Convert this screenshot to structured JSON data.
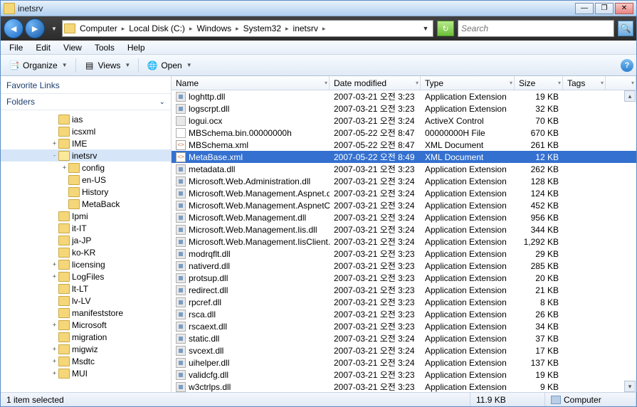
{
  "titlebar": {
    "title": "inetsrv"
  },
  "breadcrumb": [
    "Computer",
    "Local Disk (C:)",
    "Windows",
    "System32",
    "inetsrv"
  ],
  "search": {
    "placeholder": "Search"
  },
  "menubar": [
    "File",
    "Edit",
    "View",
    "Tools",
    "Help"
  ],
  "toolbar": {
    "organize": "Organize",
    "views": "Views",
    "open": "Open"
  },
  "sidebar": {
    "favorites": "Favorite Links",
    "folders_label": "Folders",
    "tree": [
      {
        "depth": 5,
        "label": "ias",
        "exp": ""
      },
      {
        "depth": 5,
        "label": "icsxml",
        "exp": ""
      },
      {
        "depth": 5,
        "label": "IME",
        "exp": "+"
      },
      {
        "depth": 5,
        "label": "inetsrv",
        "exp": "-",
        "open": true,
        "sel": true
      },
      {
        "depth": 6,
        "label": "config",
        "exp": "+"
      },
      {
        "depth": 6,
        "label": "en-US",
        "exp": ""
      },
      {
        "depth": 6,
        "label": "History",
        "exp": ""
      },
      {
        "depth": 6,
        "label": "MetaBack",
        "exp": ""
      },
      {
        "depth": 5,
        "label": "Ipmi",
        "exp": ""
      },
      {
        "depth": 5,
        "label": "it-IT",
        "exp": ""
      },
      {
        "depth": 5,
        "label": "ja-JP",
        "exp": ""
      },
      {
        "depth": 5,
        "label": "ko-KR",
        "exp": ""
      },
      {
        "depth": 5,
        "label": "licensing",
        "exp": "+"
      },
      {
        "depth": 5,
        "label": "LogFiles",
        "exp": "+"
      },
      {
        "depth": 5,
        "label": "lt-LT",
        "exp": ""
      },
      {
        "depth": 5,
        "label": "lv-LV",
        "exp": ""
      },
      {
        "depth": 5,
        "label": "manifeststore",
        "exp": ""
      },
      {
        "depth": 5,
        "label": "Microsoft",
        "exp": "+"
      },
      {
        "depth": 5,
        "label": "migration",
        "exp": ""
      },
      {
        "depth": 5,
        "label": "migwiz",
        "exp": "+"
      },
      {
        "depth": 5,
        "label": "Msdtc",
        "exp": "+"
      },
      {
        "depth": 5,
        "label": "MUI",
        "exp": "+"
      }
    ]
  },
  "columns": {
    "name": "Name",
    "date": "Date modified",
    "type": "Type",
    "size": "Size",
    "tags": "Tags"
  },
  "files": [
    {
      "name": "loghttp.dll",
      "date": "2007-03-21 오전 3:23",
      "type": "Application Extension",
      "size": "19 KB",
      "icon": "dll"
    },
    {
      "name": "logscrpt.dll",
      "date": "2007-03-21 오전 3:23",
      "type": "Application Extension",
      "size": "32 KB",
      "icon": "dll"
    },
    {
      "name": "logui.ocx",
      "date": "2007-03-21 오전 3:24",
      "type": "ActiveX Control",
      "size": "70 KB",
      "icon": "ocx"
    },
    {
      "name": "MBSchema.bin.00000000h",
      "date": "2007-05-22 오전 8:47",
      "type": "00000000H File",
      "size": "670 KB",
      "icon": "file"
    },
    {
      "name": "MBSchema.xml",
      "date": "2007-05-22 오전 8:47",
      "type": "XML Document",
      "size": "261 KB",
      "icon": "xml"
    },
    {
      "name": "MetaBase.xml",
      "date": "2007-05-22 오전 8:49",
      "type": "XML Document",
      "size": "12 KB",
      "icon": "xml",
      "selected": true
    },
    {
      "name": "metadata.dll",
      "date": "2007-03-21 오전 3:23",
      "type": "Application Extension",
      "size": "262 KB",
      "icon": "dll"
    },
    {
      "name": "Microsoft.Web.Administration.dll",
      "date": "2007-03-21 오전 3:24",
      "type": "Application Extension",
      "size": "128 KB",
      "icon": "dll"
    },
    {
      "name": "Microsoft.Web.Management.Aspnet.dll",
      "date": "2007-03-21 오전 3:24",
      "type": "Application Extension",
      "size": "124 KB",
      "icon": "dll"
    },
    {
      "name": "Microsoft.Web.Management.AspnetClient.dll",
      "date": "2007-03-21 오전 3:24",
      "type": "Application Extension",
      "size": "452 KB",
      "icon": "dll"
    },
    {
      "name": "Microsoft.Web.Management.dll",
      "date": "2007-03-21 오전 3:24",
      "type": "Application Extension",
      "size": "956 KB",
      "icon": "dll"
    },
    {
      "name": "Microsoft.Web.Management.Iis.dll",
      "date": "2007-03-21 오전 3:24",
      "type": "Application Extension",
      "size": "344 KB",
      "icon": "dll"
    },
    {
      "name": "Microsoft.Web.Management.IisClient.dll",
      "date": "2007-03-21 오전 3:24",
      "type": "Application Extension",
      "size": "1,292 KB",
      "icon": "dll"
    },
    {
      "name": "modrqflt.dll",
      "date": "2007-03-21 오전 3:23",
      "type": "Application Extension",
      "size": "29 KB",
      "icon": "dll"
    },
    {
      "name": "nativerd.dll",
      "date": "2007-03-21 오전 3:23",
      "type": "Application Extension",
      "size": "285 KB",
      "icon": "dll"
    },
    {
      "name": "protsup.dll",
      "date": "2007-03-21 오전 3:23",
      "type": "Application Extension",
      "size": "20 KB",
      "icon": "dll"
    },
    {
      "name": "redirect.dll",
      "date": "2007-03-21 오전 3:23",
      "type": "Application Extension",
      "size": "21 KB",
      "icon": "dll"
    },
    {
      "name": "rpcref.dll",
      "date": "2007-03-21 오전 3:23",
      "type": "Application Extension",
      "size": "8 KB",
      "icon": "dll"
    },
    {
      "name": "rsca.dll",
      "date": "2007-03-21 오전 3:23",
      "type": "Application Extension",
      "size": "26 KB",
      "icon": "dll"
    },
    {
      "name": "rscaext.dll",
      "date": "2007-03-21 오전 3:23",
      "type": "Application Extension",
      "size": "34 KB",
      "icon": "dll"
    },
    {
      "name": "static.dll",
      "date": "2007-03-21 오전 3:24",
      "type": "Application Extension",
      "size": "37 KB",
      "icon": "dll"
    },
    {
      "name": "svcext.dll",
      "date": "2007-03-21 오전 3:24",
      "type": "Application Extension",
      "size": "17 KB",
      "icon": "dll"
    },
    {
      "name": "uihelper.dll",
      "date": "2007-03-21 오전 3:24",
      "type": "Application Extension",
      "size": "137 KB",
      "icon": "dll"
    },
    {
      "name": "validcfg.dll",
      "date": "2007-03-21 오전 3:23",
      "type": "Application Extension",
      "size": "19 KB",
      "icon": "dll"
    },
    {
      "name": "w3ctrlps.dll",
      "date": "2007-03-21 오전 3:23",
      "type": "Application Extension",
      "size": "9 KB",
      "icon": "dll"
    }
  ],
  "status": {
    "selection": "1 item selected",
    "size": "11.9 KB",
    "computer": "Computer"
  }
}
